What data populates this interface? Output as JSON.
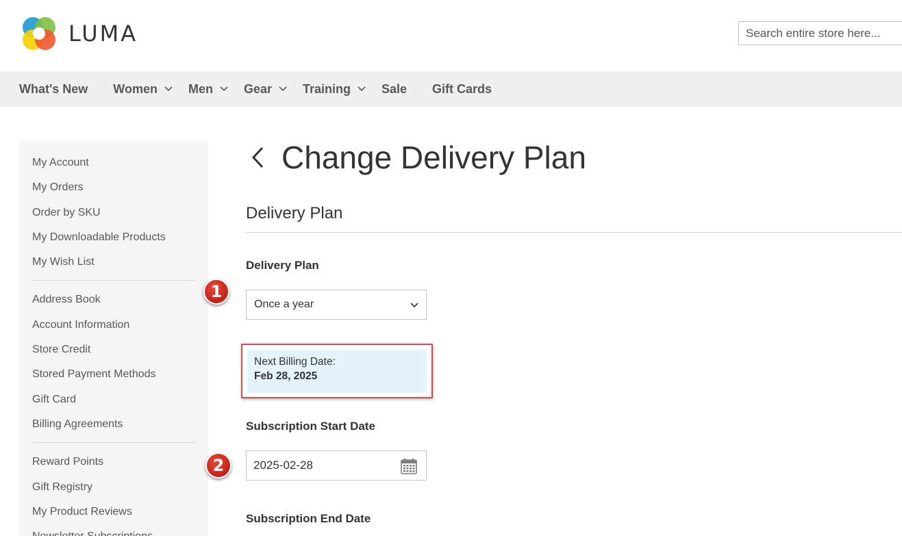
{
  "header": {
    "logo_text": "LUMA",
    "search_placeholder": "Search entire store here..."
  },
  "nav": {
    "items": [
      {
        "label": "What's New",
        "has_submenu": false
      },
      {
        "label": "Women",
        "has_submenu": true
      },
      {
        "label": "Men",
        "has_submenu": true
      },
      {
        "label": "Gear",
        "has_submenu": true
      },
      {
        "label": "Training",
        "has_submenu": true
      },
      {
        "label": "Sale",
        "has_submenu": false
      },
      {
        "label": "Gift Cards",
        "has_submenu": false
      }
    ]
  },
  "sidebar": {
    "group1": [
      "My Account",
      "My Orders",
      "Order by SKU",
      "My Downloadable Products",
      "My Wish List"
    ],
    "group2": [
      "Address Book",
      "Account Information",
      "Store Credit",
      "Stored Payment Methods",
      "Gift Card",
      "Billing Agreements"
    ],
    "group3": [
      "Reward Points",
      "Gift Registry",
      "My Product Reviews",
      "Newsletter Subscriptions"
    ]
  },
  "main": {
    "page_title": "Change Delivery Plan",
    "section_title": "Delivery Plan",
    "delivery_plan_label": "Delivery Plan",
    "delivery_plan_value": "Once a year",
    "next_billing_label": "Next Billing Date:",
    "next_billing_value": "Feb 28, 2025",
    "start_date_label": "Subscription Start Date",
    "start_date_value": "2025-02-28",
    "end_date_label": "Subscription End Date"
  },
  "markers": {
    "step1": "1",
    "step2": "2"
  },
  "colors": {
    "nav_bg": "#f0f0f0",
    "sidebar_bg": "#f5f5f5",
    "billing_bg": "#e5f3fd",
    "highlight_border": "#d24a4a",
    "marker_red": "#c9261b"
  }
}
